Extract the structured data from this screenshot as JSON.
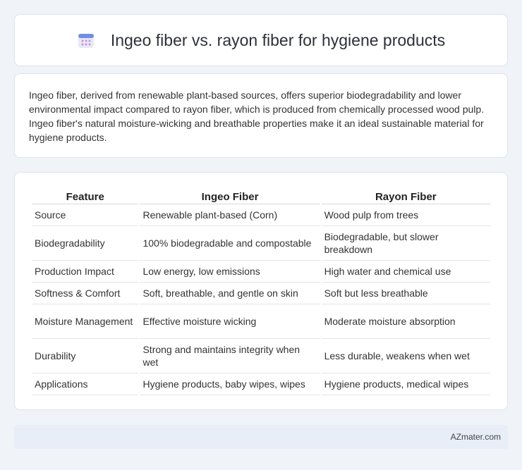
{
  "header": {
    "title": "Ingeo fiber vs. rayon fiber for hygiene products",
    "icon": "calendar-icon"
  },
  "intro": {
    "text": "Ingeo fiber, derived from renewable plant-based sources, offers superior biodegradability and lower environmental impact compared to rayon fiber, which is produced from chemically processed wood pulp. Ingeo fiber's natural moisture-wicking and breathable properties make it an ideal sustainable material for hygiene products."
  },
  "table": {
    "headers": [
      "Feature",
      "Ingeo Fiber",
      "Rayon Fiber"
    ],
    "rows": [
      [
        "Source",
        "Renewable plant-based (Corn)",
        "Wood pulp from trees"
      ],
      [
        "Biodegradability",
        "100% biodegradable and compostable",
        "Biodegradable, but slower breakdown"
      ],
      [
        "Production Impact",
        "Low energy, low emissions",
        "High water and chemical use"
      ],
      [
        "Softness & Comfort",
        "Soft, breathable, and gentle on skin",
        "Soft but less breathable"
      ],
      [
        "Moisture Management",
        "Effective moisture wicking",
        "Moderate moisture absorption"
      ],
      [
        "Durability",
        "Strong and maintains integrity when wet",
        "Less durable, weakens when wet"
      ],
      [
        "Applications",
        "Hygiene products, baby wipes, wipes",
        "Hygiene products, medical wipes"
      ]
    ]
  },
  "footer": {
    "text": "AZmater.com"
  }
}
